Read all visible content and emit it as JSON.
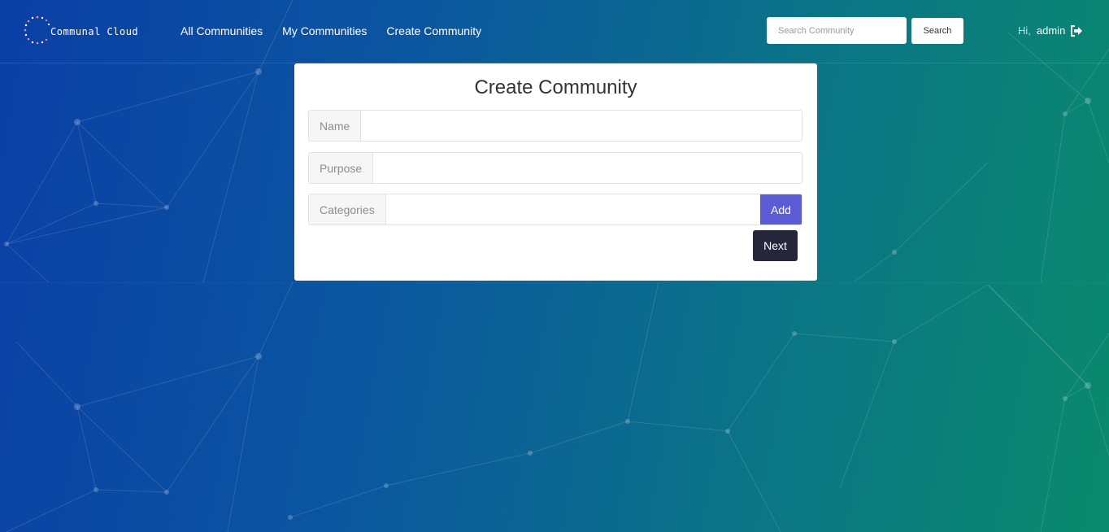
{
  "brand": {
    "name": "Communal Cloud"
  },
  "nav": {
    "all_communities": "All Communities",
    "my_communities": "My Communities",
    "create_community": "Create Community"
  },
  "search": {
    "placeholder": "Search Community",
    "value": "",
    "button_label": "Search"
  },
  "user": {
    "greeting": "Hi,",
    "name": "admin",
    "logout_icon": "sign-out-icon"
  },
  "form": {
    "title": "Create Community",
    "fields": [
      {
        "label": "Name",
        "value": ""
      },
      {
        "label": "Purpose",
        "value": ""
      },
      {
        "label": "Categories",
        "value": ""
      }
    ],
    "add_label": "Add",
    "next_label": "Next"
  },
  "colors": {
    "background_start": "#0a3fa6",
    "background_end": "#0a8a6c",
    "add_button": "#5b5bd6",
    "next_button": "#25263a"
  }
}
